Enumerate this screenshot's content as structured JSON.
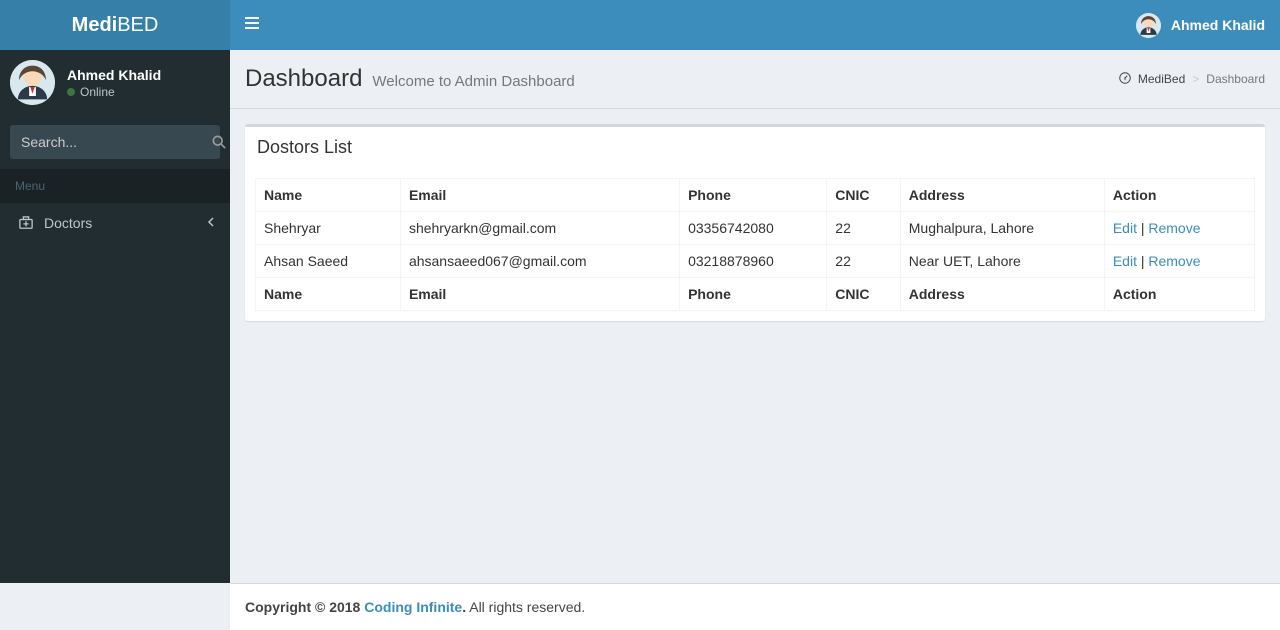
{
  "brand": {
    "bold": "Medi",
    "light": "BED"
  },
  "header": {
    "user_name": "Ahmed Khalid"
  },
  "sidebar": {
    "user_name": "Ahmed Khalid",
    "user_status": "Online",
    "search_placeholder": "Search...",
    "menu_label": "Menu",
    "items": [
      {
        "label": "Doctors"
      }
    ]
  },
  "page": {
    "title": "Dashboard",
    "subtitle": "Welcome to Admin Dashboard"
  },
  "breadcrumb": {
    "home": "MediBed",
    "current": "Dashboard"
  },
  "box": {
    "title": "Dostors List"
  },
  "table": {
    "headers": {
      "name": "Name",
      "email": "Email",
      "phone": "Phone",
      "cnic": "CNIC",
      "address": "Address",
      "action": "Action"
    },
    "rows": [
      {
        "name": "Shehryar",
        "email": "shehryarkn@gmail.com",
        "phone": "03356742080",
        "cnic": "22",
        "address": "Mughalpura, Lahore"
      },
      {
        "name": "Ahsan Saeed",
        "email": "ahsansaeed067@gmail.com",
        "phone": "03218878960",
        "cnic": "22",
        "address": "Near UET, Lahore"
      }
    ],
    "actions": {
      "edit": "Edit",
      "remove": "Remove",
      "sep": " | "
    }
  },
  "footer": {
    "copyright_prefix": "Copyright © 2018 ",
    "link_text": "Coding Infinite",
    "suffix": " All rights reserved."
  }
}
